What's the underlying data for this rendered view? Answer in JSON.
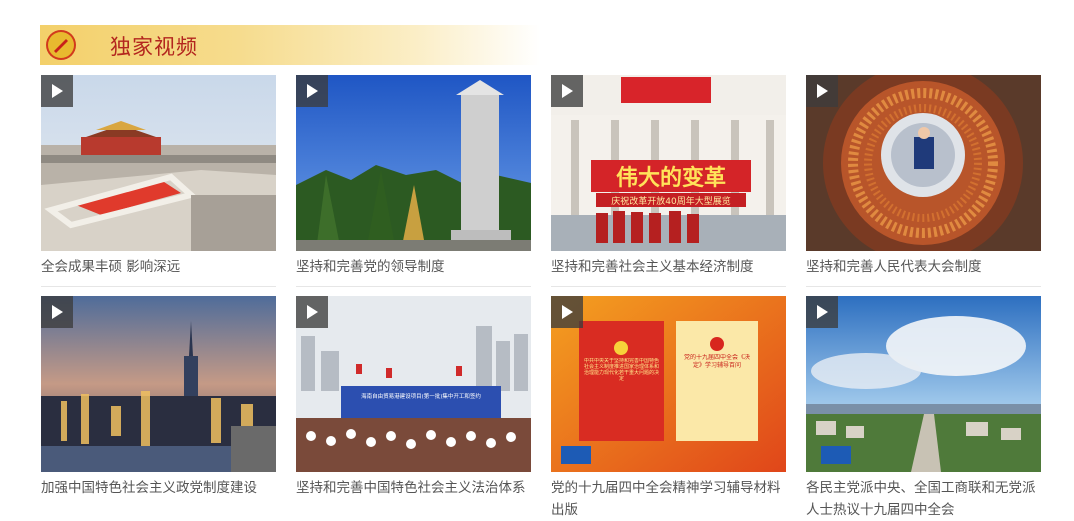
{
  "section": {
    "title": "独家视频",
    "emblem_icon": "party-emblem-icon"
  },
  "colors": {
    "title_red": "#b3261e",
    "header_gold": "#f3d06a",
    "caption_text": "#555555"
  },
  "videos": [
    {
      "caption": "全会成果丰硕 影响深远",
      "scene": "tiananmen-parade"
    },
    {
      "caption": "坚持和完善党的领导制度",
      "scene": "monument"
    },
    {
      "caption": "坚持和完善社会主义基本经济制度",
      "scene": "great-change-exhibition"
    },
    {
      "caption": "坚持和完善人民代表大会制度",
      "scene": "generator-coil"
    },
    {
      "caption": "加强中国特色社会主义政党制度建设",
      "scene": "city-skyline"
    },
    {
      "caption": "坚持和完善中国特色社会主义法治体系",
      "scene": "construction-ceremony"
    },
    {
      "caption": "党的十九届四中全会精神学习辅导材料出版",
      "scene": "books"
    },
    {
      "caption": "各民主党派中央、全国工商联和无党派人士热议十九届四中全会",
      "scene": "aerial-city"
    }
  ],
  "scene_text": {
    "banner_main": "伟大的变革",
    "banner_sub": "庆祝改革开放40周年大型展览",
    "book_left": "中共中央关于坚持和完善中国特色社会主义制度推进国家治理体系和治理能力现代化若干重大问题的决定",
    "book_right": "党的十九届四中全会《决定》学习辅导百问",
    "ceremony_board": "海南自由贸易港建设项目(第一批)集中开工和签约"
  }
}
